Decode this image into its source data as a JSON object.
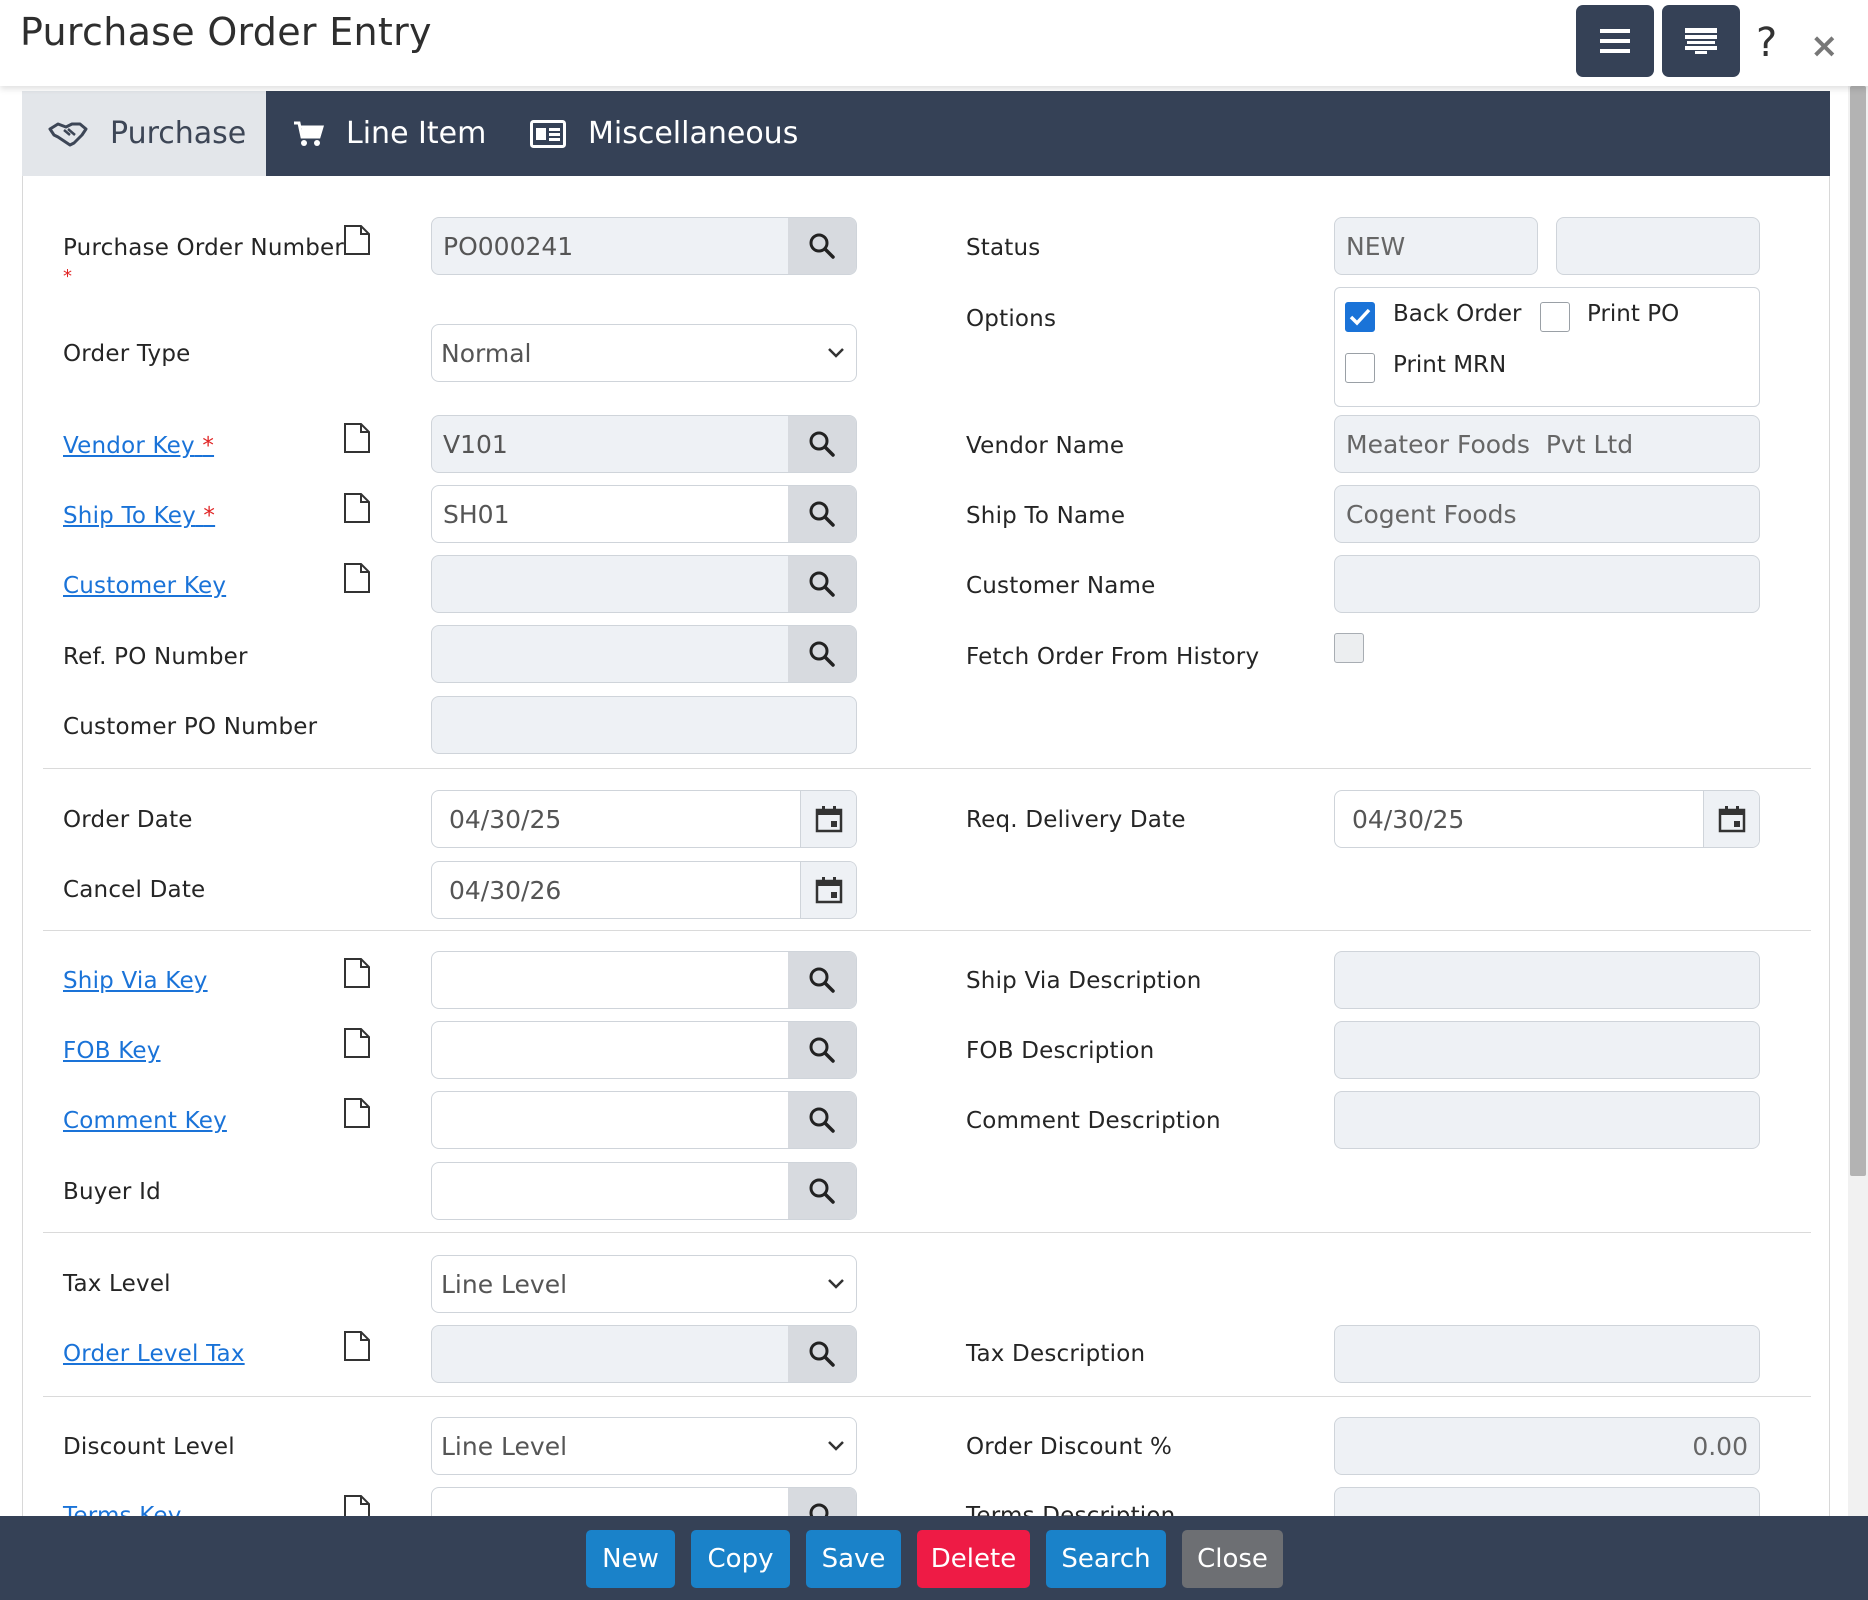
{
  "window": {
    "title": "Purchase Order Entry",
    "help": "?",
    "close": "×"
  },
  "tabs": [
    {
      "label": "Purchase",
      "icon": "handshake-icon",
      "active": true
    },
    {
      "label": "Line Item",
      "icon": "cart-icon",
      "active": false
    },
    {
      "label": "Miscellaneous",
      "icon": "id-card-icon",
      "active": false
    }
  ],
  "form": {
    "po_number": {
      "label": "Purchase Order Number",
      "req": "*",
      "value": "PO000241"
    },
    "order_type": {
      "label": "Order Type",
      "value": "Normal"
    },
    "vendor_key": {
      "label": "Vendor Key",
      "req": "*",
      "value": "V101"
    },
    "ship_to_key": {
      "label": "Ship To Key",
      "req": "*",
      "value": "SH01"
    },
    "customer_key": {
      "label": "Customer Key",
      "value": ""
    },
    "ref_po": {
      "label": "Ref. PO Number",
      "value": ""
    },
    "customer_po": {
      "label": "Customer PO Number",
      "value": ""
    },
    "status": {
      "label": "Status",
      "value": "NEW",
      "value2": ""
    },
    "options": {
      "label": "Options",
      "back_order": {
        "label": "Back Order",
        "checked": true
      },
      "print_po": {
        "label": "Print PO",
        "checked": false
      },
      "print_mrn": {
        "label": "Print MRN",
        "checked": false
      }
    },
    "vendor_name": {
      "label": "Vendor Name",
      "value": "Meateor Foods  Pvt Ltd"
    },
    "ship_to_name": {
      "label": "Ship To Name",
      "value": "Cogent Foods"
    },
    "customer_name": {
      "label": "Customer Name",
      "value": ""
    },
    "fetch_history": {
      "label": "Fetch Order From History",
      "checked": false
    },
    "order_date": {
      "label": "Order Date",
      "value": "04/30/25"
    },
    "cancel_date": {
      "label": "Cancel Date",
      "value": "04/30/26"
    },
    "req_delivery_date": {
      "label": "Req. Delivery Date",
      "value": "04/30/25"
    },
    "ship_via_key": {
      "label": "Ship Via Key",
      "value": ""
    },
    "fob_key": {
      "label": "FOB Key",
      "value": ""
    },
    "comment_key": {
      "label": "Comment Key",
      "value": ""
    },
    "buyer_id": {
      "label": "Buyer Id",
      "value": ""
    },
    "ship_via_desc": {
      "label": "Ship Via Description",
      "value": ""
    },
    "fob_desc": {
      "label": "FOB Description",
      "value": ""
    },
    "comment_desc": {
      "label": "Comment Description",
      "value": ""
    },
    "tax_level": {
      "label": "Tax Level",
      "value": "Line Level"
    },
    "order_level_tax": {
      "label": "Order Level Tax",
      "value": ""
    },
    "tax_desc": {
      "label": "Tax Description",
      "value": ""
    },
    "discount_level": {
      "label": "Discount Level",
      "value": "Line Level"
    },
    "order_discount": {
      "label": "Order Discount %",
      "value": "0.00"
    },
    "terms_key": {
      "label": "Terms Key",
      "value": ""
    },
    "terms_desc": {
      "label": "Terms Description",
      "value": ""
    }
  },
  "footer": {
    "new": "New",
    "copy": "Copy",
    "save": "Save",
    "delete": "Delete",
    "search": "Search",
    "close": "Close"
  },
  "colors": {
    "header_bg": "#354156",
    "link": "#1a73d8",
    "primary_button": "#1a82c9",
    "danger_button": "#ee1b45",
    "neutral_button": "#6d6f73",
    "checkbox_checked": "#1a73d8",
    "required": "#e02424"
  }
}
